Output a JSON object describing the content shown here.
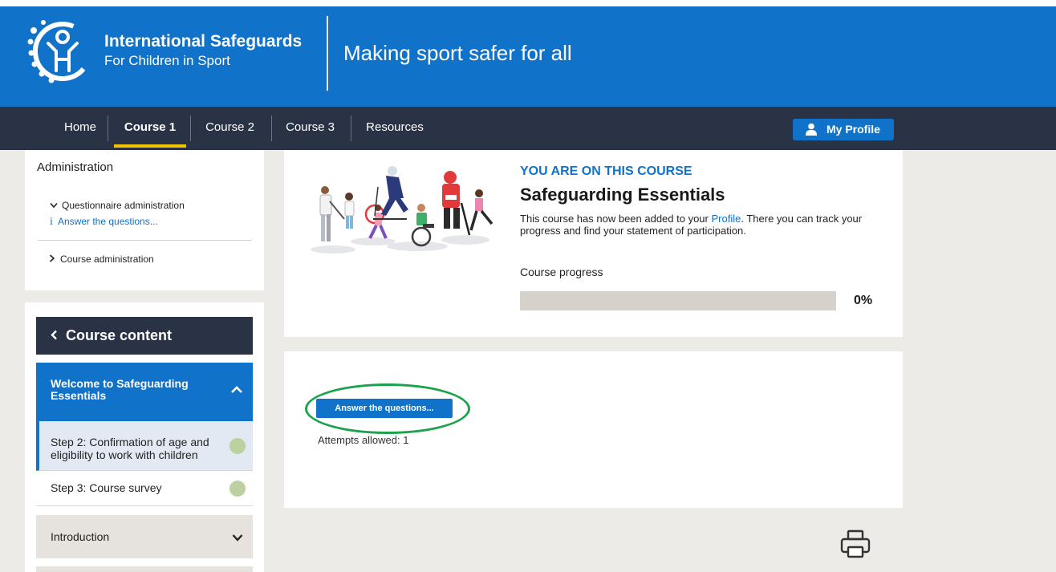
{
  "header": {
    "brand_title": "International Safeguards",
    "brand_subtitle": "For Children in Sport",
    "tagline": "Making sport safer for all",
    "logo_icon": "child-figure-logo-icon"
  },
  "nav": {
    "items": [
      {
        "label": "Home",
        "active": false
      },
      {
        "label": "Course 1",
        "active": true
      },
      {
        "label": "Course 2",
        "active": false
      },
      {
        "label": "Course 3",
        "active": false
      },
      {
        "label": "Resources",
        "active": false
      }
    ],
    "profile_label": "My Profile"
  },
  "sidebar": {
    "admin_title": "Administration",
    "questionnaire_admin": "Questionnaire administration",
    "answer_link": "Answer the questions...",
    "course_admin": "Course administration",
    "course_content_label": "Course content",
    "sections": [
      {
        "label": "Welcome to Safeguarding Essentials",
        "expanded": true
      },
      {
        "label": "Introduction",
        "expanded": false
      }
    ],
    "steps": [
      {
        "label": "Step 2: Confirmation of age and eligibility to work with children",
        "current": true
      },
      {
        "label": "Step 3: Course survey",
        "current": false
      }
    ]
  },
  "course": {
    "status": "YOU ARE ON THIS COURSE",
    "title": "Safeguarding Essentials",
    "desc_before": "This course has now been added to your ",
    "desc_link": "Profile",
    "desc_after": ". There you can track your progress and find your statement of participation.",
    "progress_label": "Course progress",
    "progress_value": 0,
    "progress_text": "0%"
  },
  "activity": {
    "button_label": "Answer the questions...",
    "attempts": "Attempts allowed: 1"
  },
  "colors": {
    "brand_blue": "#1072c8",
    "nav_dark": "#2a3346",
    "accent_yellow": "#f2c500",
    "highlight_green": "#1aa34a",
    "step_dot": "#bcd0a0"
  }
}
